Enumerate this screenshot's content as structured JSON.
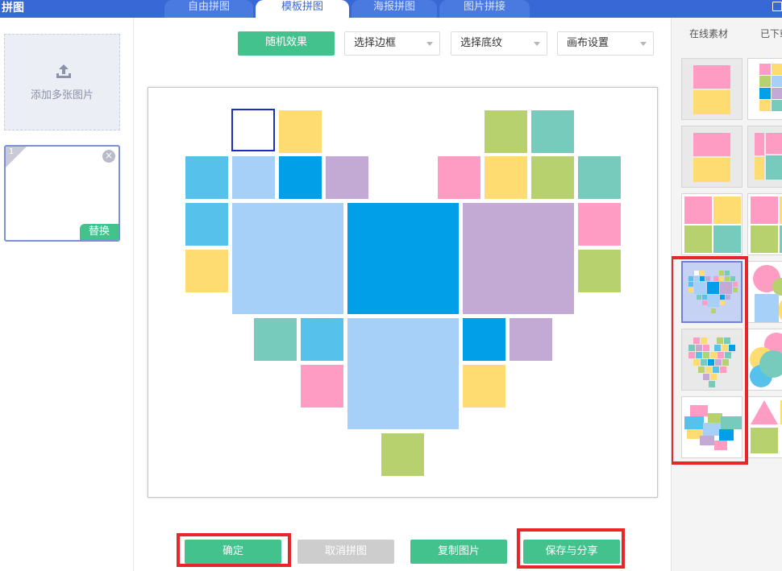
{
  "app": {
    "title": "拼图"
  },
  "tabs": [
    {
      "label": "自由拼图",
      "active": false
    },
    {
      "label": "模板拼图",
      "active": true
    },
    {
      "label": "海报拼图",
      "active": false
    },
    {
      "label": "图片拼接",
      "active": false
    }
  ],
  "left_panel": {
    "add_label": "添加多张图片",
    "thumbnail_index": "1",
    "replace_label": "替换"
  },
  "toolbar": {
    "random_label": "随机效果",
    "border_select": "选择边框",
    "background_select": "选择底纹",
    "canvas_select": "画布设置"
  },
  "bottom_buttons": {
    "confirm": "确定",
    "cancel": "取消拼图",
    "copy": "复制图片",
    "save_share": "保存与分享"
  },
  "right_panel": {
    "tab_online": "在线素材",
    "tab_downloaded": "已下载"
  },
  "colors": {
    "green": "#44c28e",
    "topbar": "#3868d6",
    "highlight": "#e8262a",
    "tile_palette": [
      "#56c1ea",
      "#a6d0f7",
      "#009fe8",
      "#c2aad4",
      "#ff9cc4",
      "#ffdc71",
      "#b6d16e",
      "#77cbbd"
    ]
  }
}
